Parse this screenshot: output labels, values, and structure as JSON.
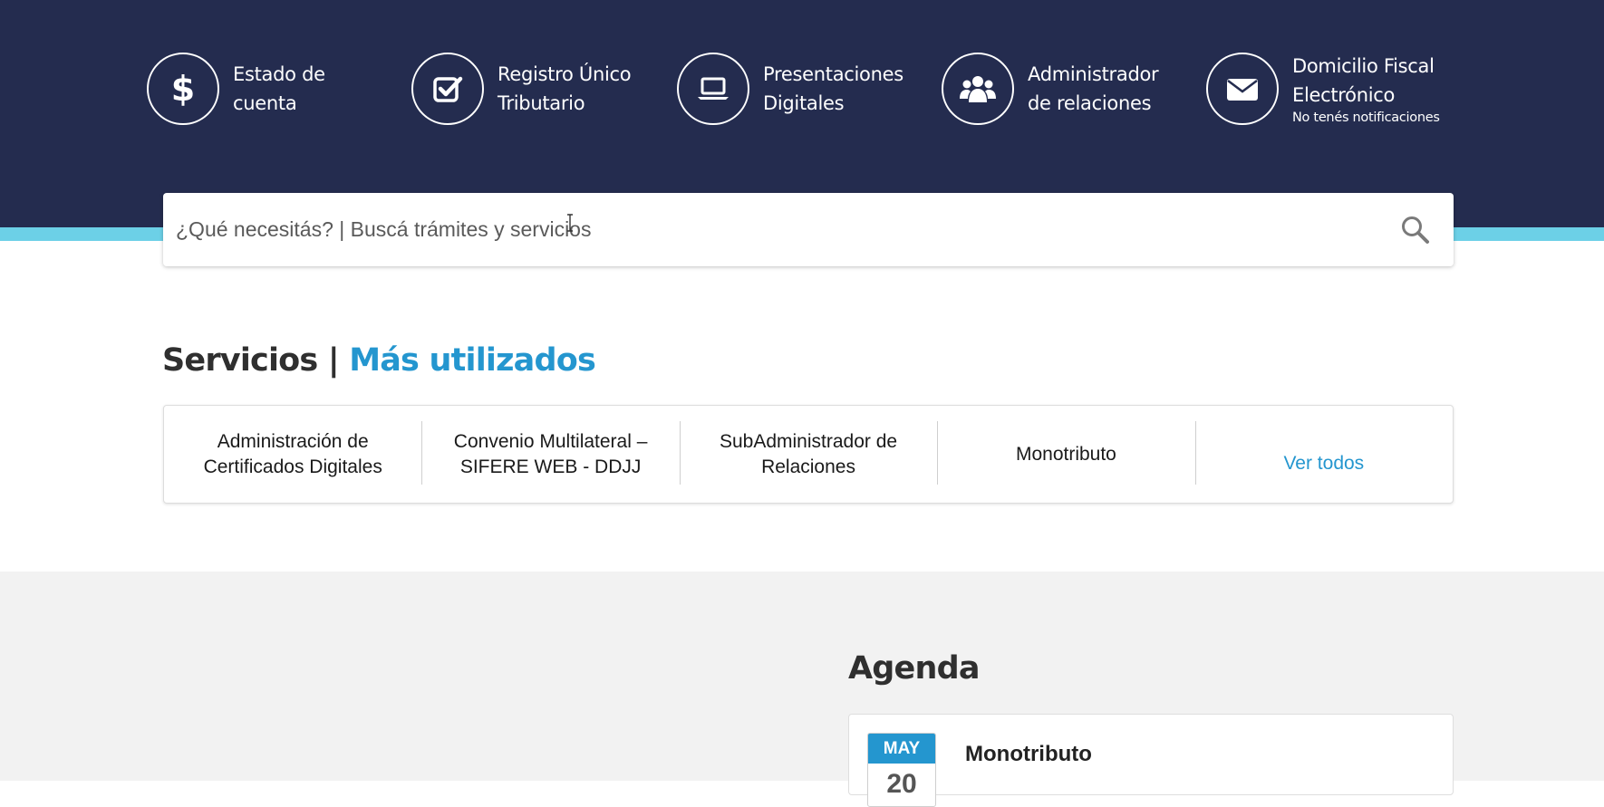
{
  "quick_links": [
    {
      "label": "Estado de cuenta",
      "icon": "dollar-icon"
    },
    {
      "label": "Registro Único Tributario",
      "icon": "check-square-icon"
    },
    {
      "label": "Presentaciones Digitales",
      "icon": "laptop-icon"
    },
    {
      "label": "Administrador de relaciones",
      "icon": "users-icon"
    },
    {
      "label": "Domicilio Fiscal Electrónico",
      "sublabel": "No tenés notificaciones",
      "icon": "envelope-icon"
    }
  ],
  "search": {
    "placeholder": "¿Qué necesitás? | Buscá trámites y servicios",
    "icon": "search-icon"
  },
  "services": {
    "title": "Servicios |",
    "highlight": "Más utilizados",
    "items": [
      "Administración de Certificados Digitales",
      "Convenio Multilateral – SIFERE WEB - DDJJ",
      "SubAdministrador de Relaciones",
      "Monotributo"
    ],
    "view_all": "Ver todos"
  },
  "agenda": {
    "title": "Agenda",
    "items": [
      {
        "month": "MAY",
        "day": "20",
        "title": "Monotributo"
      }
    ]
  },
  "colors": {
    "header": "#242c4f",
    "accent_strip": "#6cd0e7",
    "link_blue": "#2496cf",
    "section_gray": "#f2f2f2"
  }
}
